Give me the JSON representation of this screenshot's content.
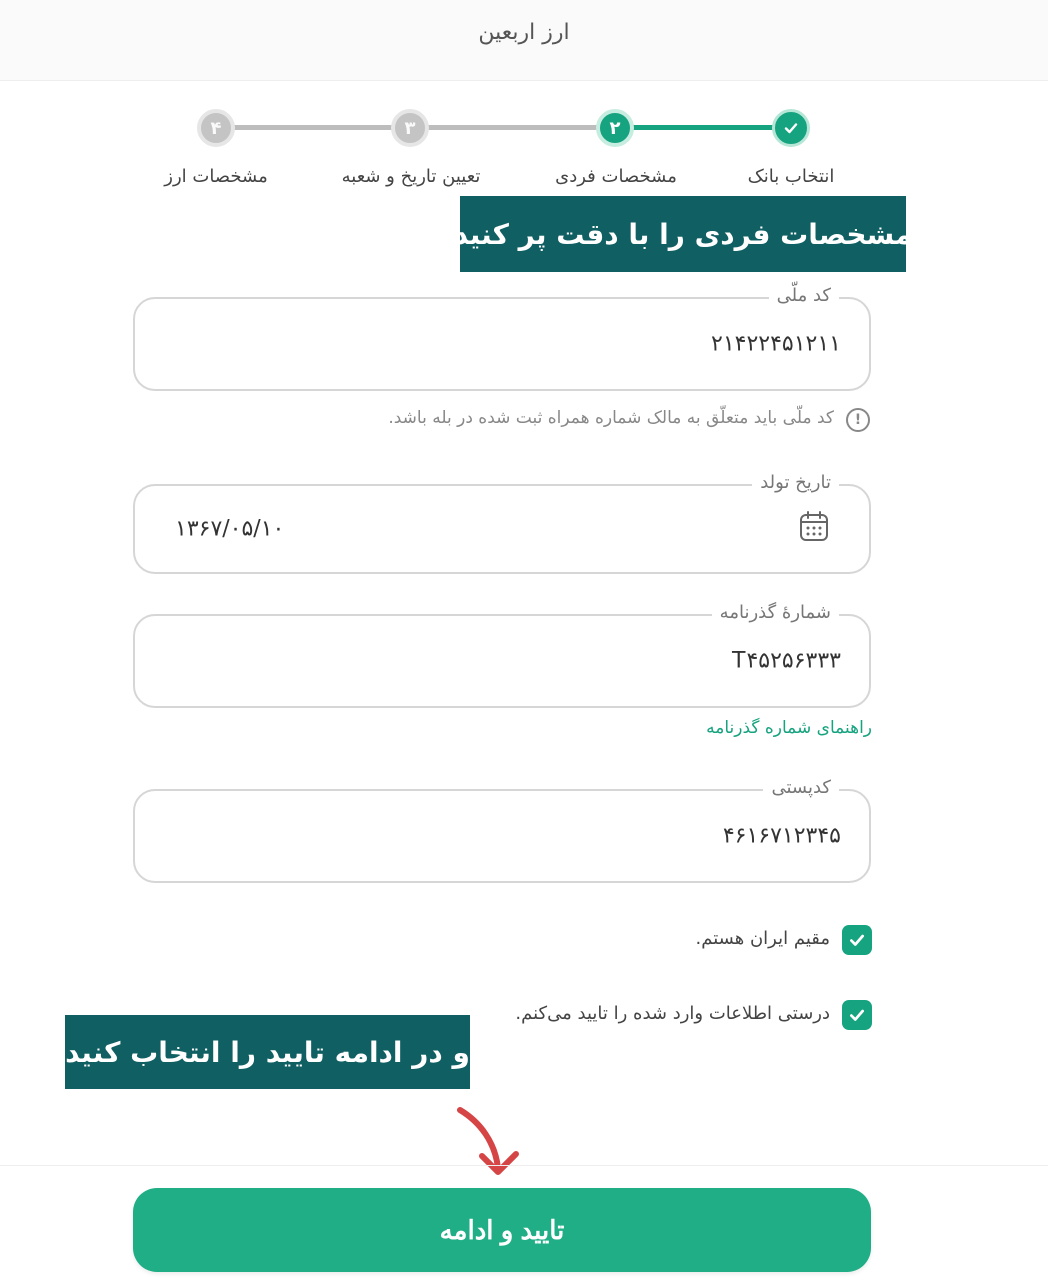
{
  "header": {
    "title": "ارز اربعین"
  },
  "stepper": {
    "steps": [
      {
        "number": "✓",
        "label": "انتخاب بانک",
        "state": "done"
      },
      {
        "number": "۲",
        "label": "مشخصات فردی",
        "state": "current"
      },
      {
        "number": "۳",
        "label": "تعیین تاریخ و شعبه",
        "state": "pending"
      },
      {
        "number": "۴",
        "label": "مشخصات ارز",
        "state": "pending"
      }
    ]
  },
  "banners": {
    "top": "مشخصات فردی را با دقت  پر کنید",
    "bottom": "و در ادامه تایید را انتخاب کنید"
  },
  "form": {
    "national_code": {
      "label": "کد ملّی",
      "value": "۲۱۴۲۲۴۵۱۲۱۱",
      "hint": "کد ملّی باید متعلّق به مالک شماره همراه ثبت شده در بله باشد."
    },
    "birth_date": {
      "label": "تاریخ تولد",
      "value": "۱۳۶۷/۰۵/۱۰"
    },
    "passport": {
      "label": "شمارهٔ گذرنامه",
      "value": "T۴۵۲۵۶۳۳۳",
      "guide_link": "راهنمای شماره گذرنامه"
    },
    "postal_code": {
      "label": "کدپستی",
      "value": "۴۶۱۶۷۱۲۳۴۵"
    }
  },
  "checkboxes": {
    "resident": {
      "label": "مقیم ایران هستم.",
      "checked": true
    },
    "confirm": {
      "label": "درستی اطلاعات وارد شده را تایید می‌کنم.",
      "checked": true
    }
  },
  "submit": {
    "label": "تایید و ادامه"
  },
  "colors": {
    "accent": "#16a37f",
    "banner": "#0f5f63",
    "arrow": "#d64545"
  }
}
